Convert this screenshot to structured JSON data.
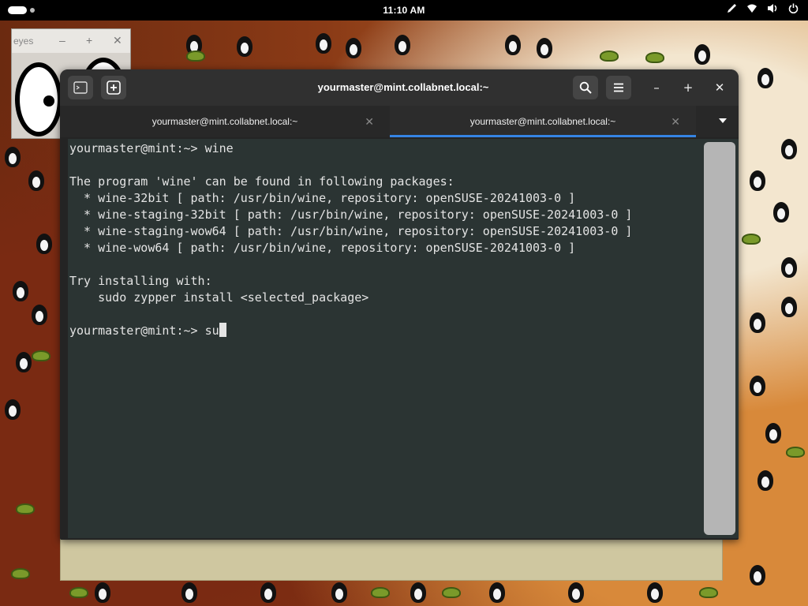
{
  "topbar": {
    "clock": "11:10 AM",
    "tray_icons": [
      "pen-icon",
      "network-icon",
      "volume-icon",
      "power-icon"
    ]
  },
  "xeyes": {
    "title": "eyes"
  },
  "terminal": {
    "window_title": "yourmaster@mint.collabnet.local:~",
    "tabs": [
      {
        "label": "yourmaster@mint.collabnet.local:~",
        "active": false
      },
      {
        "label": "yourmaster@mint.collabnet.local:~",
        "active": true
      }
    ],
    "lines": [
      "yourmaster@mint:~> wine",
      "",
      "The program 'wine' can be found in following packages:",
      "  * wine-32bit [ path: /usr/bin/wine, repository: openSUSE-20241003-0 ]",
      "  * wine-staging-32bit [ path: /usr/bin/wine, repository: openSUSE-20241003-0 ]",
      "  * wine-staging-wow64 [ path: /usr/bin/wine, repository: openSUSE-20241003-0 ]",
      "  * wine-wow64 [ path: /usr/bin/wine, repository: openSUSE-20241003-0 ]",
      "",
      "Try installing with:",
      "    sudo zypper install <selected_package>",
      ""
    ],
    "prompt": "yourmaster@mint:~> ",
    "current_input": "su"
  },
  "colors": {
    "terminal_bg": "#2b3433",
    "headerbar": "#303030",
    "accent": "#3584e4"
  }
}
